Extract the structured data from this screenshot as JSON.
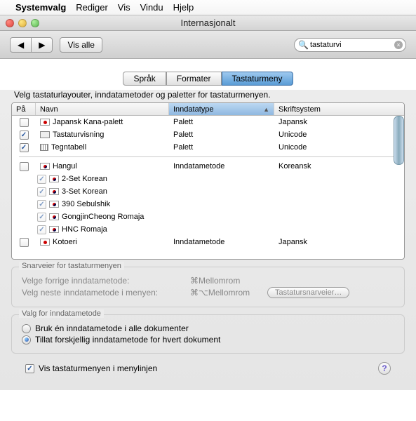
{
  "menubar": {
    "app": "Systemvalg",
    "items": [
      "Rediger",
      "Vis",
      "Vindu",
      "Hjelp"
    ]
  },
  "window": {
    "title": "Internasjonalt"
  },
  "toolbar": {
    "showall": "Vis alle",
    "search_value": "tastaturvi"
  },
  "tabs": {
    "lang": "Språk",
    "formats": "Formater",
    "kbmenu": "Tastaturmeny"
  },
  "instruction": "Velg tastaturlayouter, inndatametoder og paletter for tastaturmenyen.",
  "columns": {
    "on": "På",
    "name": "Navn",
    "type": "Inndatatype",
    "script": "Skriftsystem"
  },
  "rows": {
    "r1": {
      "name": "Japansk Kana-palett",
      "type": "Palett",
      "script": "Japansk"
    },
    "r2": {
      "name": "Tastaturvisning",
      "type": "Palett",
      "script": "Unicode"
    },
    "r3": {
      "name": "Tegntabell",
      "type": "Palett",
      "script": "Unicode"
    },
    "r4": {
      "name": "Hangul",
      "type": "Inndatametode",
      "script": "Koreansk"
    },
    "r4a": "2-Set Korean",
    "r4b": "3-Set Korean",
    "r4c": "390 Sebulshik",
    "r4d": "GongjinCheong Romaja",
    "r4e": "HNC Romaja",
    "r5": {
      "name": "Kotoeri",
      "type": "Inndatametode",
      "script": "Japansk"
    }
  },
  "shortcuts": {
    "legend": "Snarveier for tastaturmenyen",
    "prev_label": "Velge forrige inndatametode:",
    "prev_key": "⌘Mellomrom",
    "next_label": "Velg neste inndatametode i menyen:",
    "next_key": "⌘⌥Mellomrom",
    "button": "Tastatursnarveier…"
  },
  "options": {
    "legend": "Valg for inndatametode",
    "one": "Bruk én inndatametode i alle dokumenter",
    "diff": "Tillat forskjellig inndatametode for hvert dokument"
  },
  "footer": {
    "showmenu": "Vis tastaturmenyen i menylinjen"
  }
}
